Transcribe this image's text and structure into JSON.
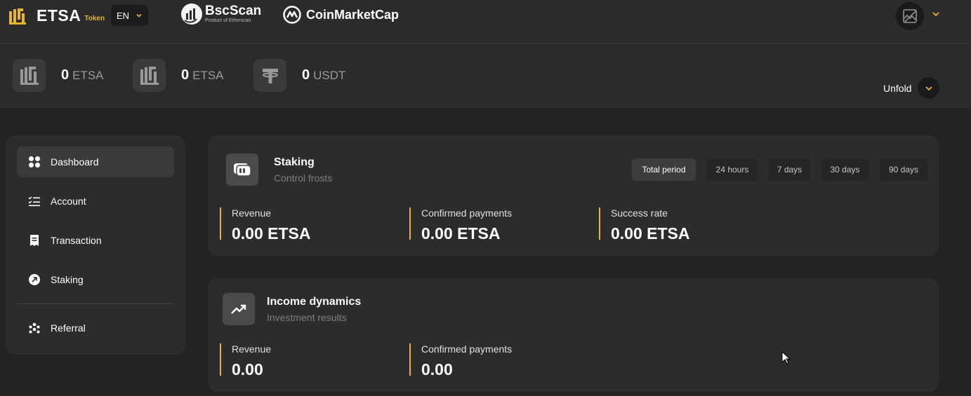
{
  "header": {
    "logo": "ETSA",
    "logo_sub": "Token",
    "language": "EN",
    "bscscan_title": "BscScan",
    "bscscan_sub": "Product of Etherscan",
    "coinmarketcap": "CoinMarketCap"
  },
  "balances": [
    {
      "value": "0",
      "unit": "ETSA",
      "icon": "etsa-icon"
    },
    {
      "value": "0",
      "unit": "ETSA",
      "icon": "etsa-icon"
    },
    {
      "value": "0",
      "unit": "USDT",
      "icon": "tether-icon"
    }
  ],
  "unfold_label": "Unfold",
  "sidebar": {
    "items": [
      {
        "label": "Dashboard",
        "icon": "grid-icon",
        "active": true
      },
      {
        "label": "Account",
        "icon": "checklist-icon"
      },
      {
        "label": "Transaction",
        "icon": "receipt-icon"
      },
      {
        "label": "Staking",
        "icon": "arrow-circle-icon"
      },
      {
        "label": "Referral",
        "icon": "people-icon"
      }
    ]
  },
  "staking": {
    "title": "Staking",
    "subtitle": "Control frosts",
    "periods": [
      "Total period",
      "24 hours",
      "7 days",
      "30 days",
      "90 days"
    ],
    "active_period": "Total period",
    "stats": [
      {
        "label": "Revenue",
        "value": "0.00 ETSA"
      },
      {
        "label": "Confirmed payments",
        "value": "0.00 ETSA"
      },
      {
        "label": "Success rate",
        "value": "0.00 ETSA"
      }
    ]
  },
  "income": {
    "title": "Income dynamics",
    "subtitle": "Investment results",
    "stats": [
      {
        "label": "Revenue",
        "value": "0.00"
      },
      {
        "label": "Confirmed payments",
        "value": "0.00"
      }
    ]
  },
  "colors": {
    "accent": "#e5b530",
    "background": "#232323",
    "panel": "#2c2c2c"
  }
}
